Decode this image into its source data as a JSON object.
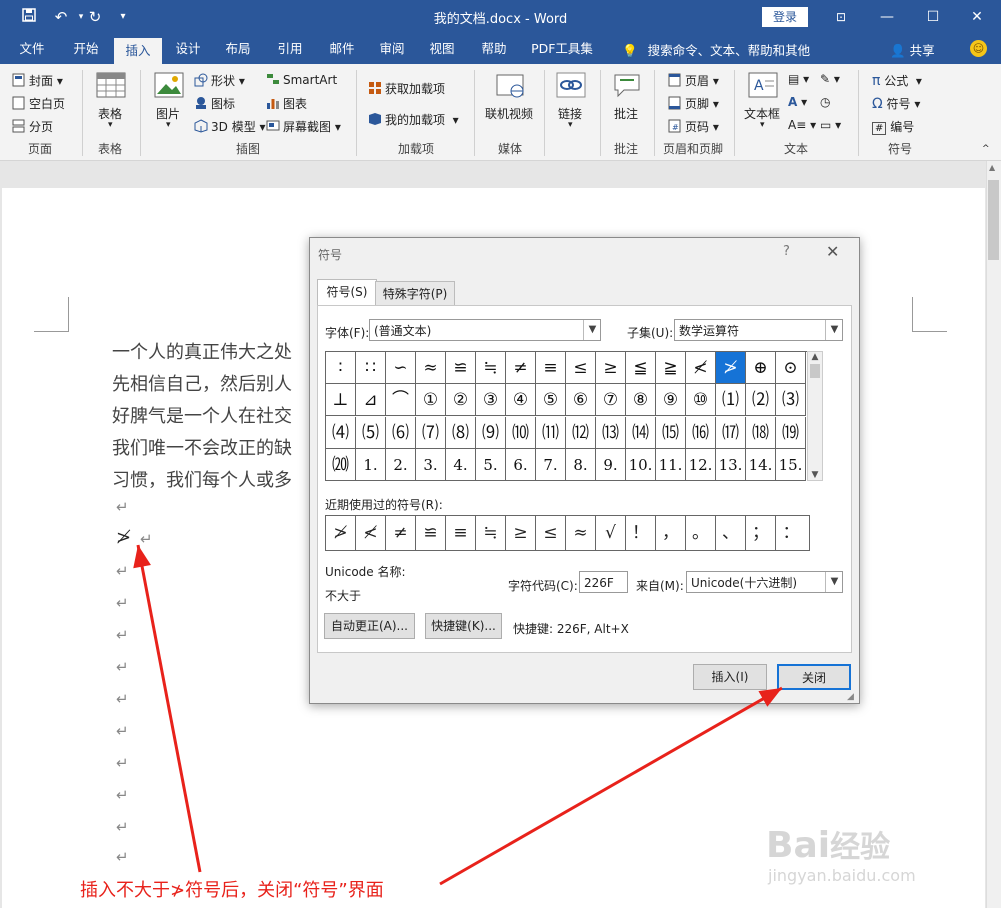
{
  "window": {
    "title": "我的文档.docx  -  Word",
    "login": "登录",
    "quick_access": [
      "save-icon",
      "undo-icon",
      "redo-icon",
      "customize-icon"
    ]
  },
  "tabs": [
    "文件",
    "开始",
    "插入",
    "设计",
    "布局",
    "引用",
    "邮件",
    "审阅",
    "视图",
    "帮助",
    "PDF工具集"
  ],
  "active_tab": "插入",
  "tell_me": "搜索命令、文本、帮助和其他",
  "share": "共享",
  "ribbon": {
    "pages": {
      "cover": "封面",
      "blank": "空白页",
      "break": "分页",
      "group": "页面"
    },
    "tables": {
      "table": "表格",
      "group": "表格"
    },
    "illustrations": {
      "picture": "图片",
      "shapes": "形状",
      "icons": "图标",
      "model3d": "3D 模型",
      "smartart": "SmartArt",
      "chart": "图表",
      "screenshot": "屏幕截图",
      "group": "插图"
    },
    "addins": {
      "get": "获取加载项",
      "mine": "我的加载项",
      "group": "加载项"
    },
    "media": {
      "video": "联机视频",
      "group": "媒体"
    },
    "links": {
      "link": "链接"
    },
    "comments": {
      "comment": "批注",
      "group": "批注"
    },
    "header_footer": {
      "header": "页眉",
      "footer": "页脚",
      "page_number": "页码",
      "group": "页眉和页脚"
    },
    "text": {
      "textbox": "文本框",
      "group": "文本"
    },
    "symbols": {
      "equation": "公式",
      "symbol": "符号",
      "numbering": "编号",
      "group": "符号"
    }
  },
  "document": {
    "lines": [
      "一个人的真正伟大之处",
      "先相信自己，然后别人",
      "好脾气是一个人在社交",
      "我们唯一不会改正的缺",
      "习惯，我们每个人或多"
    ],
    "inserted_symbol": "≯",
    "para_mark": "↵"
  },
  "dialog": {
    "title": "符号",
    "help": "?",
    "close_x": "✕",
    "tab_symbols": "符号(S)",
    "tab_special": "特殊字符(P)",
    "font_label": "字体(F):",
    "font_value": "(普通文本)",
    "subset_label": "子集(U):",
    "subset_value": "数学运算符",
    "grid_rows": [
      [
        "∶",
        "∷",
        "∽",
        "≈",
        "≌",
        "≒",
        "≠",
        "≡",
        "≤",
        "≥",
        "≦",
        "≧",
        "≮",
        "≯",
        "⊕",
        "⊙"
      ],
      [
        "⊥",
        "⊿",
        "⌒",
        "①",
        "②",
        "③",
        "④",
        "⑤",
        "⑥",
        "⑦",
        "⑧",
        "⑨",
        "⑩",
        "⑴",
        "⑵",
        "⑶"
      ],
      [
        "⑷",
        "⑸",
        "⑹",
        "⑺",
        "⑻",
        "⑼",
        "⑽",
        "⑾",
        "⑿",
        "⒀",
        "⒁",
        "⒂",
        "⒃",
        "⒄",
        "⒅",
        "⒆"
      ],
      [
        "⒇",
        "1.",
        "2.",
        "3.",
        "4.",
        "5.",
        "6.",
        "7.",
        "8.",
        "9.",
        "10.",
        "11.",
        "12.",
        "13.",
        "14.",
        "15."
      ]
    ],
    "selected_symbol": "≯",
    "recent_label": "近期使用过的符号(R):",
    "recent": [
      "≯",
      "≮",
      "≠",
      "≌",
      "≡",
      "≒",
      "≥",
      "≤",
      "≈",
      "√",
      "！",
      "，",
      "。",
      "、",
      "；",
      "："
    ],
    "unicode_name_label": "Unicode 名称:",
    "unicode_name": "不大于",
    "char_code_label": "字符代码(C):",
    "char_code": "226F",
    "from_label": "来自(M):",
    "from_value": "Unicode(十六进制)",
    "autocorrect_btn": "自动更正(A)...",
    "shortcut_btn": "快捷键(K)...",
    "shortcut_text": "快捷键: 226F, Alt+X",
    "insert_btn": "插入(I)",
    "close_btn": "关闭"
  },
  "annotation": {
    "caption": "插入不大于≯符号后，关闭“符号”界面",
    "arrow_color": "#e8221b"
  },
  "watermark": {
    "brand": "Bai经验",
    "url": "jingyan.baidu.com"
  }
}
